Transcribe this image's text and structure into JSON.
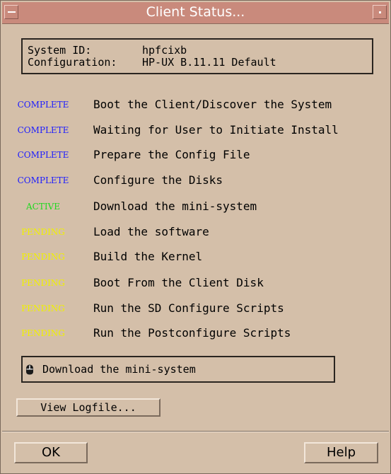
{
  "window": {
    "title": "Client Status..."
  },
  "system": {
    "id_label": "System ID:",
    "id_value": "hpfcixb",
    "config_label": "Configuration:",
    "config_value": "HP-UX B.11.11 Default"
  },
  "steps": [
    {
      "status": "COMPLETE",
      "label": "Boot the Client/Discover the System"
    },
    {
      "status": "COMPLETE",
      "label": "Waiting for User to Initiate Install"
    },
    {
      "status": "COMPLETE",
      "label": "Prepare the Config File"
    },
    {
      "status": "COMPLETE",
      "label": "Configure the Disks"
    },
    {
      "status": "ACTIVE",
      "label": "Download the mini-system"
    },
    {
      "status": "PENDING",
      "label": "Load the software"
    },
    {
      "status": "PENDING",
      "label": "Build the Kernel"
    },
    {
      "status": "PENDING",
      "label": "Boot From the Client Disk"
    },
    {
      "status": "PENDING",
      "label": "Run the SD Configure Scripts"
    },
    {
      "status": "PENDING",
      "label": "Run the Postconfigure Scripts"
    }
  ],
  "status_colors": {
    "COMPLETE": "#1c1cff",
    "ACTIVE": "#1fd81f",
    "PENDING": "#f0f000"
  },
  "current": {
    "icon": "mouse-icon",
    "text": "Download the mini-system"
  },
  "buttons": {
    "view_logfile": "View Logfile...",
    "ok": "OK",
    "help": "Help"
  }
}
